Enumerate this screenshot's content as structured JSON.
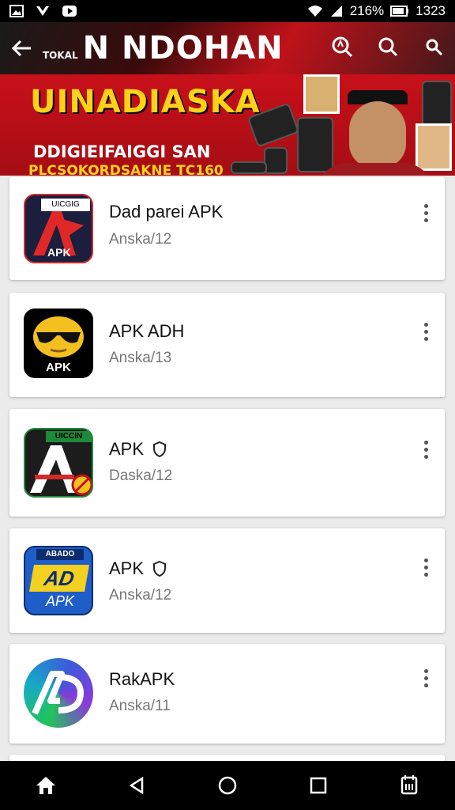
{
  "status_bar": {
    "battery_text": "216%",
    "time": "1323"
  },
  "toolbar": {
    "title_small": "TOKAL",
    "title": "N NDOHAN"
  },
  "banner": {
    "headline": "UINADIASKA",
    "subline1": "DDIGIEIFAIGGI SAN",
    "subline2": "PLCSOKORDSAKNE TC160"
  },
  "apps": [
    {
      "title": "Dad parei APK",
      "subtitle": "Anska/12",
      "icon_label": "APK",
      "icon_top_text": "UICGIG",
      "shield": false
    },
    {
      "title": "APK ADH",
      "subtitle": "Anska/13",
      "icon_label": "APK",
      "shield": false
    },
    {
      "title": "APK",
      "subtitle": "Daska/12",
      "icon_top_text": "UICCIN",
      "shield": true
    },
    {
      "title": "APK",
      "subtitle": "Anska/12",
      "icon_label": "APK",
      "icon_main": "AD",
      "icon_top_text": "ABADO",
      "shield": true
    },
    {
      "title": "RakAPK",
      "subtitle": "Anska/11",
      "shield": false
    }
  ],
  "colors": {
    "banner_red": "#c8101a",
    "headline_yellow": "#ffd21a"
  }
}
